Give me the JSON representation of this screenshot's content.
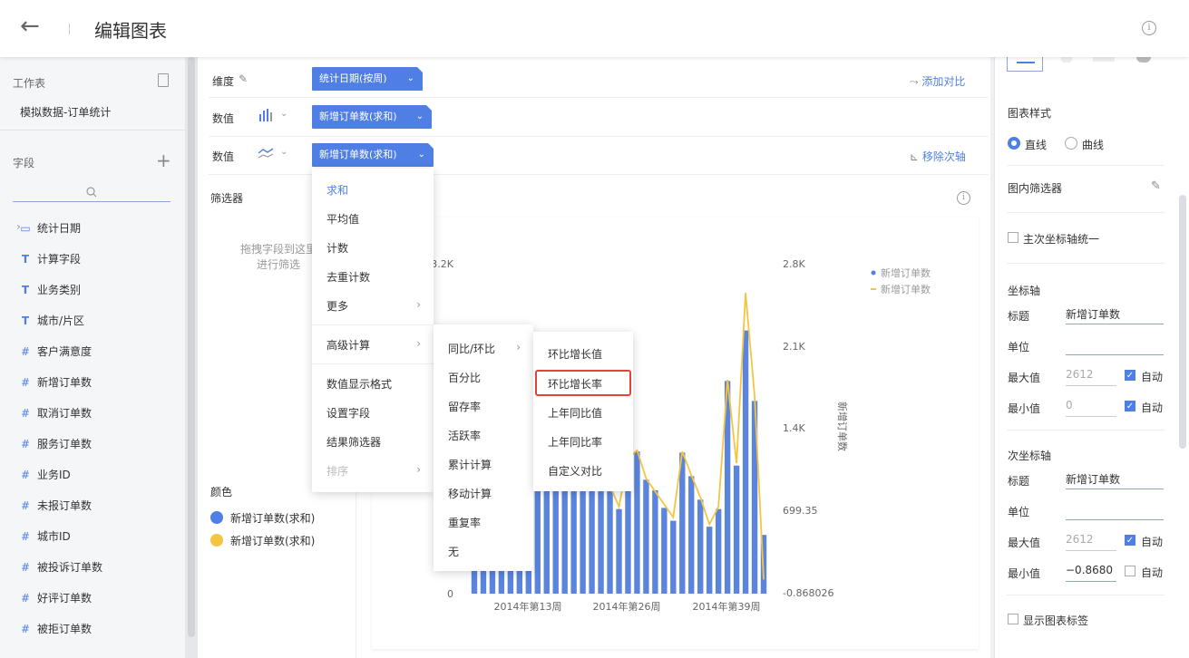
{
  "header": {
    "title": "编辑图表"
  },
  "left": {
    "worksheet_label": "工作表",
    "worksheet_name": "模拟数据-订单统计",
    "fields_label": "字段",
    "fields": [
      {
        "icon": "date",
        "name": "统计日期"
      },
      {
        "icon": "T",
        "name": "计算字段"
      },
      {
        "icon": "T",
        "name": "业务类别"
      },
      {
        "icon": "T",
        "name": "城市/片区"
      },
      {
        "icon": "#",
        "name": "客户满意度"
      },
      {
        "icon": "#",
        "name": "新增订单数"
      },
      {
        "icon": "#",
        "name": "取消订单数"
      },
      {
        "icon": "#",
        "name": "服务订单数"
      },
      {
        "icon": "#",
        "name": "业务ID"
      },
      {
        "icon": "#",
        "name": "未报订单数"
      },
      {
        "icon": "#",
        "name": "城市ID"
      },
      {
        "icon": "#",
        "name": "被投诉订单数"
      },
      {
        "icon": "#",
        "name": "好评订单数"
      },
      {
        "icon": "#",
        "name": "被拒订单数"
      }
    ]
  },
  "shelf": {
    "dimension_label": "维度",
    "dimension_chip": "统计日期(按周)",
    "add_compare": "添加对比",
    "value_label1": "数值",
    "value_chip1": "新增订单数(求和)",
    "value_label2": "数值",
    "value_chip2": "新增订单数(求和)",
    "remove_axis": "移除次轴"
  },
  "filter": {
    "label": "筛选器",
    "hint1": "拖拽字段到这里",
    "hint2": "进行筛选"
  },
  "color": {
    "label": "颜色",
    "items": [
      {
        "name": "新增订单数(求和)",
        "color": "#4f7fe4"
      },
      {
        "name": "新增订单数(求和)",
        "color": "#f5c542"
      }
    ]
  },
  "menu1": {
    "items": [
      "求和",
      "平均值",
      "计数",
      "去重计数",
      "更多",
      "高级计算",
      "数值显示格式",
      "设置字段",
      "结果筛选器",
      "排序"
    ]
  },
  "menu2": {
    "items": [
      "同比/环比",
      "百分比",
      "留存率",
      "活跃率",
      "累计计算",
      "移动计算",
      "重复率",
      "无"
    ]
  },
  "menu3": {
    "items": [
      "环比增长值",
      "环比增长率",
      "上年同比值",
      "上年同比率",
      "自定义对比"
    ]
  },
  "chart_data": {
    "type": "bar",
    "left_ticks": [
      "3.2K",
      "0"
    ],
    "right_ticks": [
      "2.8K",
      "2.1K",
      "1.4K",
      "699.35",
      "-0.868026"
    ],
    "y2label": "新增订单数",
    "x_ticks": [
      "2014年第13周",
      "2014年第26周",
      "2014年第39周"
    ],
    "legend": [
      "新增订单数",
      "新增订单数"
    ],
    "series": [
      {
        "name": "新增订单数",
        "kind": "bar",
        "values": [
          1060,
          920,
          1240,
          1500,
          1150,
          1390,
          1300,
          1050,
          1240,
          1520,
          1010,
          1200,
          1160,
          1150,
          1010,
          920,
          720,
          1140,
          1210,
          970,
          880,
          730,
          620,
          1200,
          1000,
          800,
          570,
          720,
          1810,
          1090,
          2240,
          1640,
          500
        ]
      },
      {
        "name": "新增订单数",
        "kind": "line",
        "values": [
          1040,
          930,
          1230,
          1480,
          1170,
          1380,
          1310,
          1060,
          1230,
          1500,
          1020,
          1190,
          1180,
          1130,
          1020,
          920,
          740,
          1150,
          1220,
          980,
          870,
          760,
          650,
          1210,
          1010,
          820,
          590,
          740,
          1820,
          1110,
          2560,
          1680,
          120
        ]
      }
    ]
  },
  "right": {
    "style_label": "图表样式",
    "style_opt1": "直线",
    "style_opt2": "曲线",
    "inner_filter": "图内筛选器",
    "unify_axis": "主次坐标轴统一",
    "axis_label": "坐标轴",
    "title_label": "标题",
    "title_value": "新增订单数",
    "unit_label": "单位",
    "max_label": "最大值",
    "max_value": "2612",
    "min_label": "最小值",
    "min_value": "0",
    "auto_label": "自动",
    "axis2_label": "次坐标轴",
    "title2_value": "新增订单数",
    "max2_value": "2612",
    "min2_value": "−0.8680",
    "show_labels": "显示图表标签"
  }
}
